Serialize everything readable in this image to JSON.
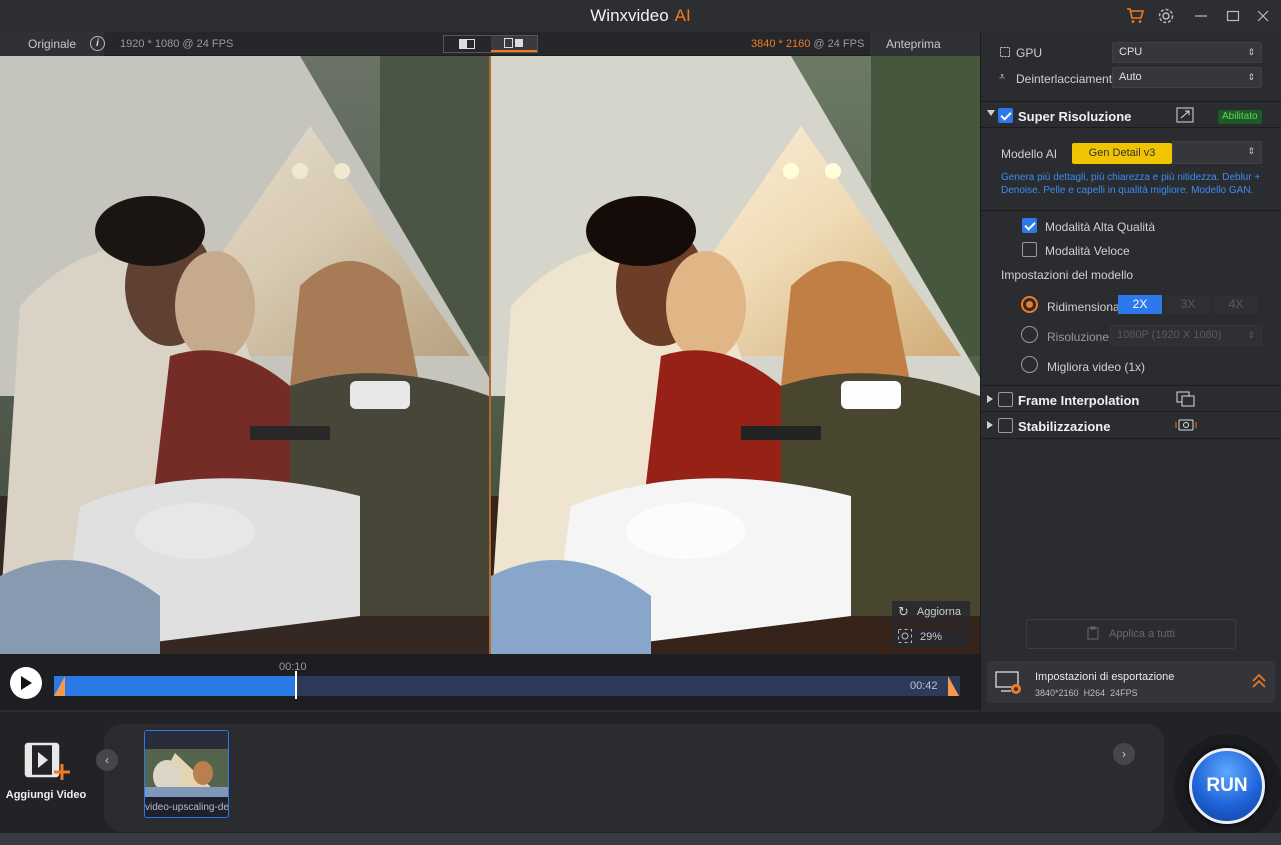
{
  "window": {
    "title": "Winxvideo",
    "title_suffix": "AI"
  },
  "preview_header": {
    "original_label": "Originale",
    "original_resolution": "1920 * 1080 @ 24 FPS",
    "output_resolution_value": "3840 * 2160",
    "output_resolution_suffix": "@ 24 FPS",
    "preview_label": "Anteprima"
  },
  "preview_overlay": {
    "refresh_label": "Aggiorna",
    "zoom_level": "29%"
  },
  "timeline": {
    "current_time": "00:10",
    "end_time": "00:42",
    "progress_fraction": 0.267
  },
  "settings": {
    "gpu_label": "GPU",
    "gpu_value": "CPU",
    "deinterlace_label": "Deinterlacciamento",
    "deinterlace_value": "Auto",
    "super_resolution": {
      "title": "Super Risoluzione",
      "enabled": true,
      "badge": "Abilitato",
      "model_label": "Modello AI",
      "model_value": "Gen Detail v3",
      "description": "Genera più dettagli, più chiarezza e più nitidezza. Deblur + Denoise. Pelle e capelli in qualità migliore. Modello GAN.",
      "high_quality_label": "Modalità Alta Qualità",
      "high_quality_checked": true,
      "fast_mode_label": "Modalità Veloce",
      "fast_mode_checked": false,
      "model_settings_label": "Impostazioni del modello",
      "resize_label": "Ridimensiona",
      "scale_options": [
        "2X",
        "3X",
        "4X"
      ],
      "resolution_label": "Risoluzione",
      "resolution_value": "1080P (1920 X 1080)",
      "enhance_label": "Migliora video (1x)"
    },
    "frame_interpolation": {
      "title": "Frame Interpolation",
      "enabled": false
    },
    "stabilization": {
      "title": "Stabilizzazione",
      "enabled": false
    },
    "apply_all_label": "Applica a tutti"
  },
  "export": {
    "title": "Impostazioni di esportazione",
    "resolution": "3840*2160",
    "codec": "H264",
    "fps": "24FPS"
  },
  "bottom": {
    "add_video_label": "Aggiungi Video",
    "thumb_filename": "video-upscaling-demo",
    "run_label": "RUN"
  },
  "colors": {
    "accent_orange": "#f07a22",
    "accent_blue": "#2b79ea",
    "model_yellow": "#f0c400",
    "enabled_green": "#5ed16a"
  }
}
